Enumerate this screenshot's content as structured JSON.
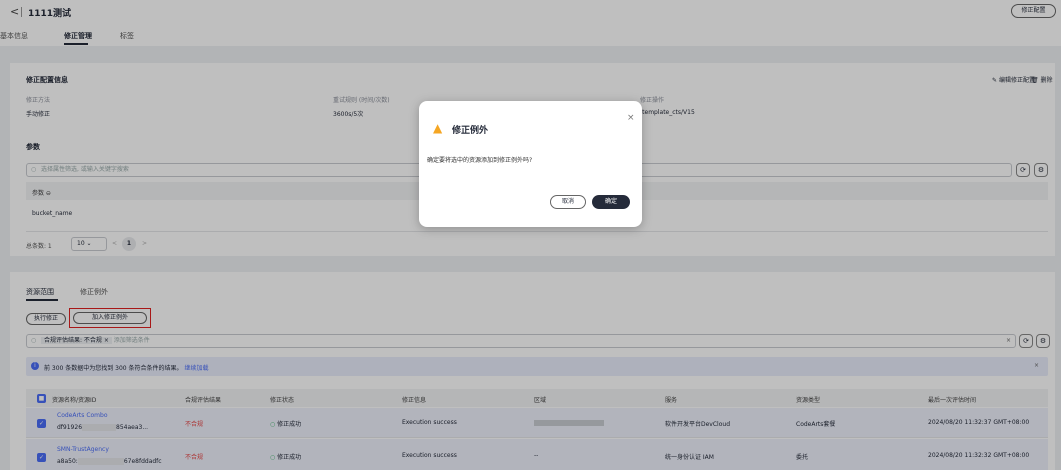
{
  "header": {
    "back": "<",
    "title": "1111测试",
    "fix_config_btn": "修正配置",
    "tabs": [
      "基本信息",
      "修正管理",
      "标签"
    ]
  },
  "config": {
    "title": "修正配置信息",
    "edit": "编辑修正配置",
    "delete": "删除",
    "method_label": "修正方法",
    "method_value": "手动修正",
    "retry_label": "重试规则 (时间/次数)",
    "retry_value": "3600s/5次",
    "op_label": "修正操作",
    "op_value": "-template_cts/V15",
    "params_title": "参数",
    "filter_placeholder": "选择属性筛选, 或输入关键字搜索",
    "param_col": "参数 ⊖",
    "param_row": "bucket_name",
    "total_label": "总条数: 1",
    "page_size": "10",
    "page_num": "1"
  },
  "resources": {
    "tabs": [
      "资源范围",
      "修正例外"
    ],
    "execute_btn": "执行修正",
    "add_exception_btn": "加入修正例外",
    "filter_tag": "合规评估结果: 不合规",
    "filter_placeholder": "添加筛选条件",
    "info": "前 300 条数据中为您找到 300 条符合条件的结果。",
    "info_link": "继续加载",
    "columns": [
      "资源名称/资源ID",
      "合规评估结果",
      "修正状态",
      "修正信息",
      "区域",
      "服务",
      "资源类型",
      "最后一次评估时间"
    ],
    "rows": [
      {
        "name": "CodeArts Combo",
        "id1": "df91926",
        "id2": "854aea3...",
        "result": "不合规",
        "status": "修正成功",
        "info": "Execution success",
        "region": "",
        "service": "软件开发平台DevCloud",
        "type": "CodeArts套餐",
        "time": "2024/08/20 11:32:37 GMT+08:00"
      },
      {
        "name": "SMN-TrustAgency",
        "id1": "a8a50:",
        "id2": "67e8fddadfc",
        "result": "不合规",
        "status": "修正成功",
        "info": "Execution success",
        "region": "--",
        "service": "统一身份认证 IAM",
        "type": "委托",
        "time": "2024/08/20 11:32:32 GMT+08:00"
      }
    ]
  },
  "modal": {
    "title": "修正例外",
    "message": "确定要将选中的资源添加到修正例外吗?",
    "cancel": "取消",
    "confirm": "确定",
    "close": "×"
  },
  "colors": {
    "accent": "#4a6cf7",
    "danger": "#e54545",
    "success": "#3fb36b",
    "warning": "#f5a623"
  }
}
